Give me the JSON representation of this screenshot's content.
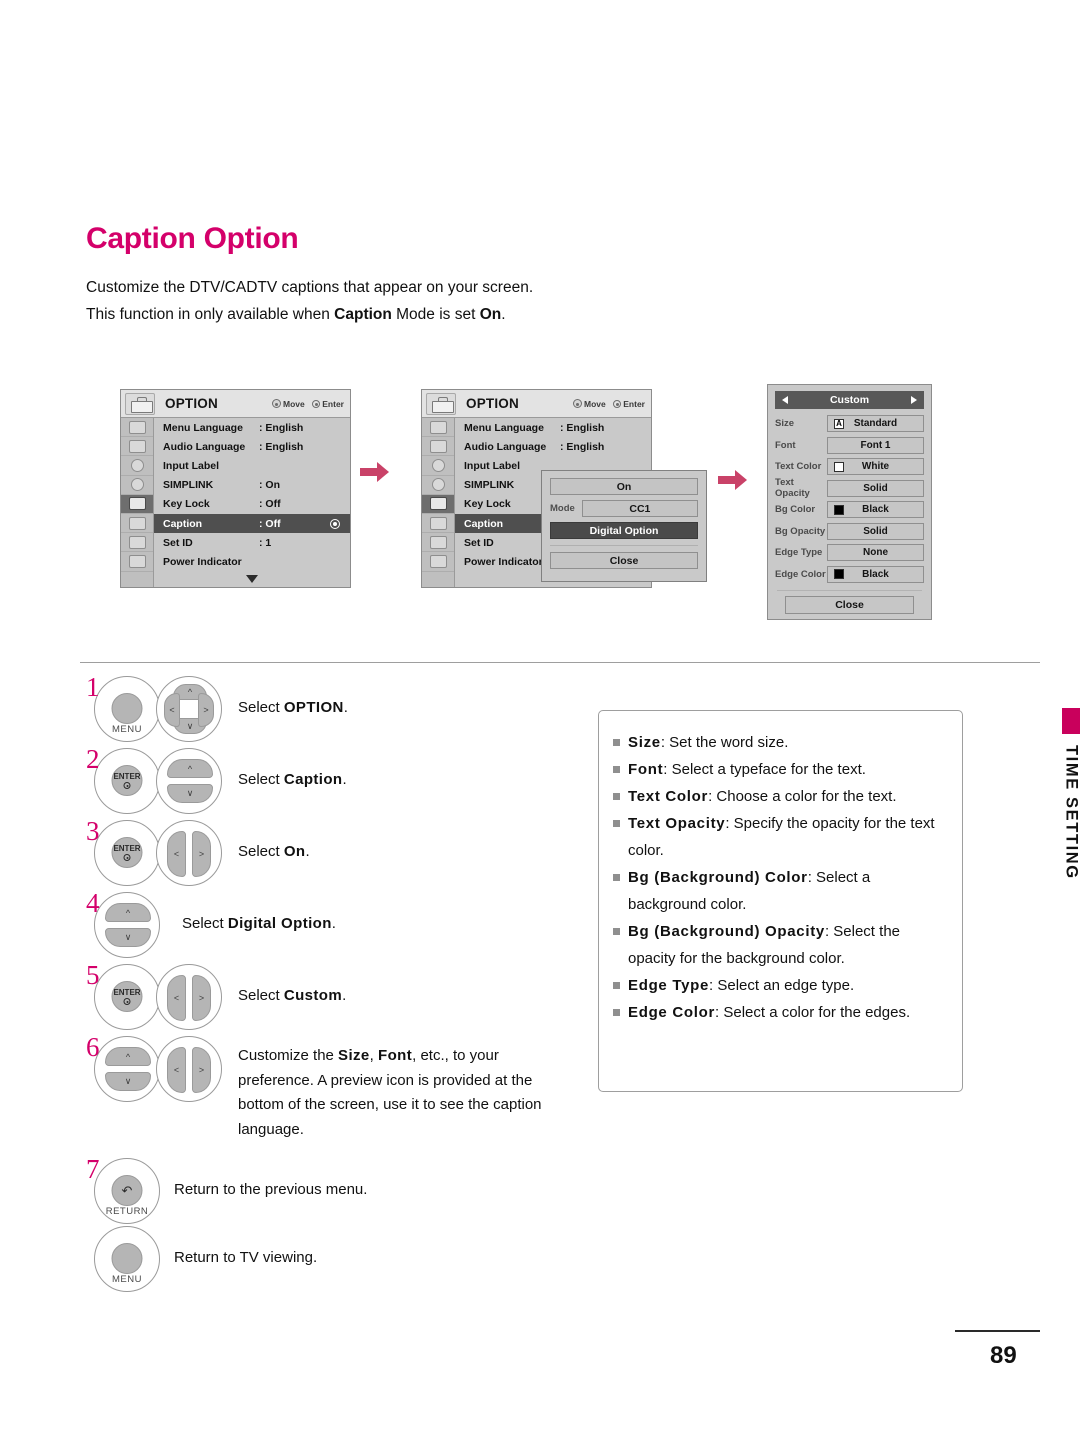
{
  "page": {
    "title": "Caption Option",
    "intro_line1_pre": "Customize the DTV/CADTV captions that appear on your screen.",
    "intro_line2_a": "This function in only available when ",
    "intro_line2_b": "Caption",
    "intro_line2_c": " Mode is set ",
    "intro_line2_d": "On",
    "intro_line2_e": ".",
    "number": "89",
    "side_tab": "TIME SETTING",
    "accent_color": "#d4006a",
    "arrow_color": "#c94268"
  },
  "osd_menu": {
    "title": "OPTION",
    "hint_move": "Move",
    "hint_enter": "Enter",
    "rows": [
      {
        "label": "Menu Language",
        "value": ": English"
      },
      {
        "label": "Audio Language",
        "value": ": English"
      },
      {
        "label": "Input Label",
        "value": ""
      },
      {
        "label": "SIMPLINK",
        "value": ": On"
      },
      {
        "label": "Key Lock",
        "value": ": Off"
      },
      {
        "label": "Caption",
        "value": ": Off"
      },
      {
        "label": "Set ID",
        "value": ": 1"
      },
      {
        "label": "Power Indicator",
        "value": ""
      }
    ],
    "selected_row_index": 5,
    "scroll_indicator": "caret-down-icon"
  },
  "caption_popup": {
    "on_label": "On",
    "mode_label": "Mode",
    "mode_value": "CC1",
    "digital_option_label": "Digital Option",
    "close_label": "Close"
  },
  "custom_panel": {
    "header_title": "Custom",
    "prev_icon": "triangle-left-icon",
    "next_icon": "triangle-right-icon",
    "rows": [
      {
        "label": "Size",
        "value": "Standard",
        "swatch": "letter-a"
      },
      {
        "label": "Font",
        "value": "Font 1",
        "swatch": "none"
      },
      {
        "label": "Text Color",
        "value": "White",
        "swatch": "white"
      },
      {
        "label": "Text Opacity",
        "value": "Solid",
        "swatch": "none"
      },
      {
        "label": "Bg Color",
        "value": "Black",
        "swatch": "black"
      },
      {
        "label": "Bg Opacity",
        "value": "Solid",
        "swatch": "none"
      },
      {
        "label": "Edge Type",
        "value": "None",
        "swatch": "none"
      },
      {
        "label": "Edge Color",
        "value": "Black",
        "swatch": "black"
      }
    ],
    "close_label": "Close"
  },
  "steps": [
    {
      "num": "1",
      "buttons": [
        "MENU",
        "dpad-4way"
      ],
      "text_pre": "Select ",
      "text_bold": "OPTION",
      "text_post": "."
    },
    {
      "num": "2",
      "buttons": [
        "ENTER",
        "dpad-updown"
      ],
      "text_pre": "Select ",
      "text_bold": "Caption",
      "text_post": "."
    },
    {
      "num": "3",
      "buttons": [
        "ENTER",
        "dpad-leftright"
      ],
      "text_pre": "Select ",
      "text_bold": "On",
      "text_post": "."
    },
    {
      "num": "4",
      "buttons": [
        "dpad-updown"
      ],
      "text_pre": "Select ",
      "text_bold": "Digital Option",
      "text_post": "."
    },
    {
      "num": "5",
      "buttons": [
        "ENTER",
        "dpad-leftright"
      ],
      "text_pre": "Select ",
      "text_bold": "Custom",
      "text_post": "."
    },
    {
      "num": "6",
      "buttons": [
        "dpad-updown",
        "dpad-leftright"
      ],
      "text_pre": "Customize the ",
      "text_bold": "Size",
      "text_mid": ", ",
      "text_bold2": "Font",
      "text_post": ", etc., to your preference. A preview icon is provided at the bottom of the screen, use it to see the caption language."
    },
    {
      "num": "7",
      "buttons": [
        "RETURN"
      ],
      "text_plain": "Return to the previous menu."
    },
    {
      "num": "",
      "buttons": [
        "MENU"
      ],
      "text_plain": "Return to TV viewing."
    }
  ],
  "button_labels": {
    "menu": "MENU",
    "enter": "ENTER",
    "return": "RETURN"
  },
  "info_box": {
    "items": [
      {
        "term": "Size",
        "desc": ": Set the word size."
      },
      {
        "term": "Font",
        "desc": ": Select a typeface for the text."
      },
      {
        "term": "Text Color",
        "desc": ": Choose a color for the text."
      },
      {
        "term": "Text Opacity",
        "desc": ": Specify the opacity for the text color."
      },
      {
        "term": "Bg (Background) Color",
        "desc": ": Select a background color."
      },
      {
        "term": "Bg (Background) Opacity",
        "desc": ": Select the opacity for the background color."
      },
      {
        "term": "Edge Type",
        "desc": ": Select an edge type."
      },
      {
        "term": "Edge Color",
        "desc": ": Select a color for the edges."
      }
    ]
  }
}
